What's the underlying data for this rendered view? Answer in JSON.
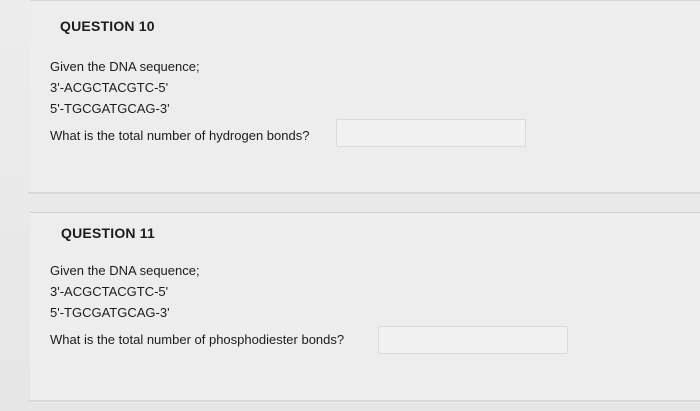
{
  "questions": [
    {
      "title": "QUESTION 10",
      "intro": "Given the DNA sequence;",
      "strand1": "3'-ACGCTACGTC-5'",
      "strand2": "5'-TGCGATGCAG-3'",
      "prompt": "What is the total number of hydrogen bonds?",
      "answer": ""
    },
    {
      "title": "QUESTION 11",
      "intro": "Given the DNA sequence;",
      "strand1": "3'-ACGCTACGTC-5'",
      "strand2": "5'-TGCGATGCAG-3'",
      "prompt": "What is the total number of phosphodiester bonds?",
      "answer": ""
    }
  ]
}
